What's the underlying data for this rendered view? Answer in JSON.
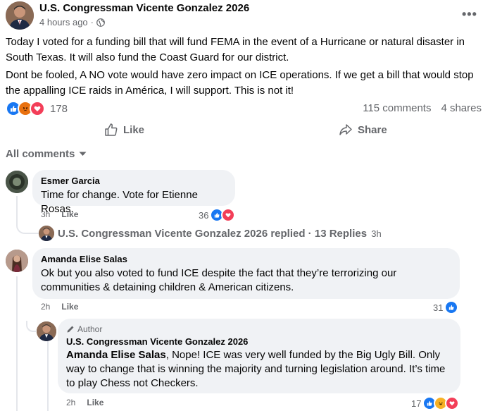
{
  "post": {
    "author": "U.S. Congressman Vicente Gonzalez 2026",
    "time": "4 hours ago",
    "dot": "·",
    "more_label": "•••",
    "para1": "Today I voted for a funding bill that will fund FEMA in the event of a Hurricane or natural disaster in South Texas. It will also fund the Coast Guard for our district.",
    "para2": "Dont be fooled, A NO vote would have zero impact on ICE operations. If we get a bill that would stop the appalling ICE raids in América, I will support.  This is not it!",
    "reaction_count": "178",
    "comments_count": "115 comments",
    "shares_count": "4 shares",
    "like_label": "Like",
    "share_label": "Share"
  },
  "comments_header": "All comments",
  "comments": [
    {
      "name": "Esmer Garcia",
      "text": "Time for change. Vote for Etienne Rosas.",
      "time": "3h",
      "like": "Like",
      "reactions": "36",
      "reply_summary": "U.S. Congressman Vicente Gonzalez 2026 replied · 13 Replies",
      "reply_time": "3h"
    },
    {
      "name": "Amanda Elise Salas",
      "text": "Ok but you also voted to fund ICE despite the fact that they’re terrorizing our communities & detaining children & American citizens.",
      "time": "2h",
      "like": "Like",
      "reactions": "31"
    }
  ],
  "reply": {
    "badge": "Author",
    "name": "U.S. Congressman Vicente Gonzalez 2026",
    "mention": "Amanda Elise Salas",
    "text": ", Nope! ICE was very well funded by the Big Ugly Bill. Only way to change that is winning the majority and turning legislation around. It’s time to play Chess not Checkers.",
    "time": "2h",
    "like": "Like",
    "reactions": "17"
  },
  "colors": {
    "like_blue": "#1877f2",
    "love_red": "#f33e58",
    "angry_orange": "#e9710f",
    "haha_yellow": "#f7b125",
    "muted": "#65676b",
    "bubble": "#f0f2f5"
  }
}
